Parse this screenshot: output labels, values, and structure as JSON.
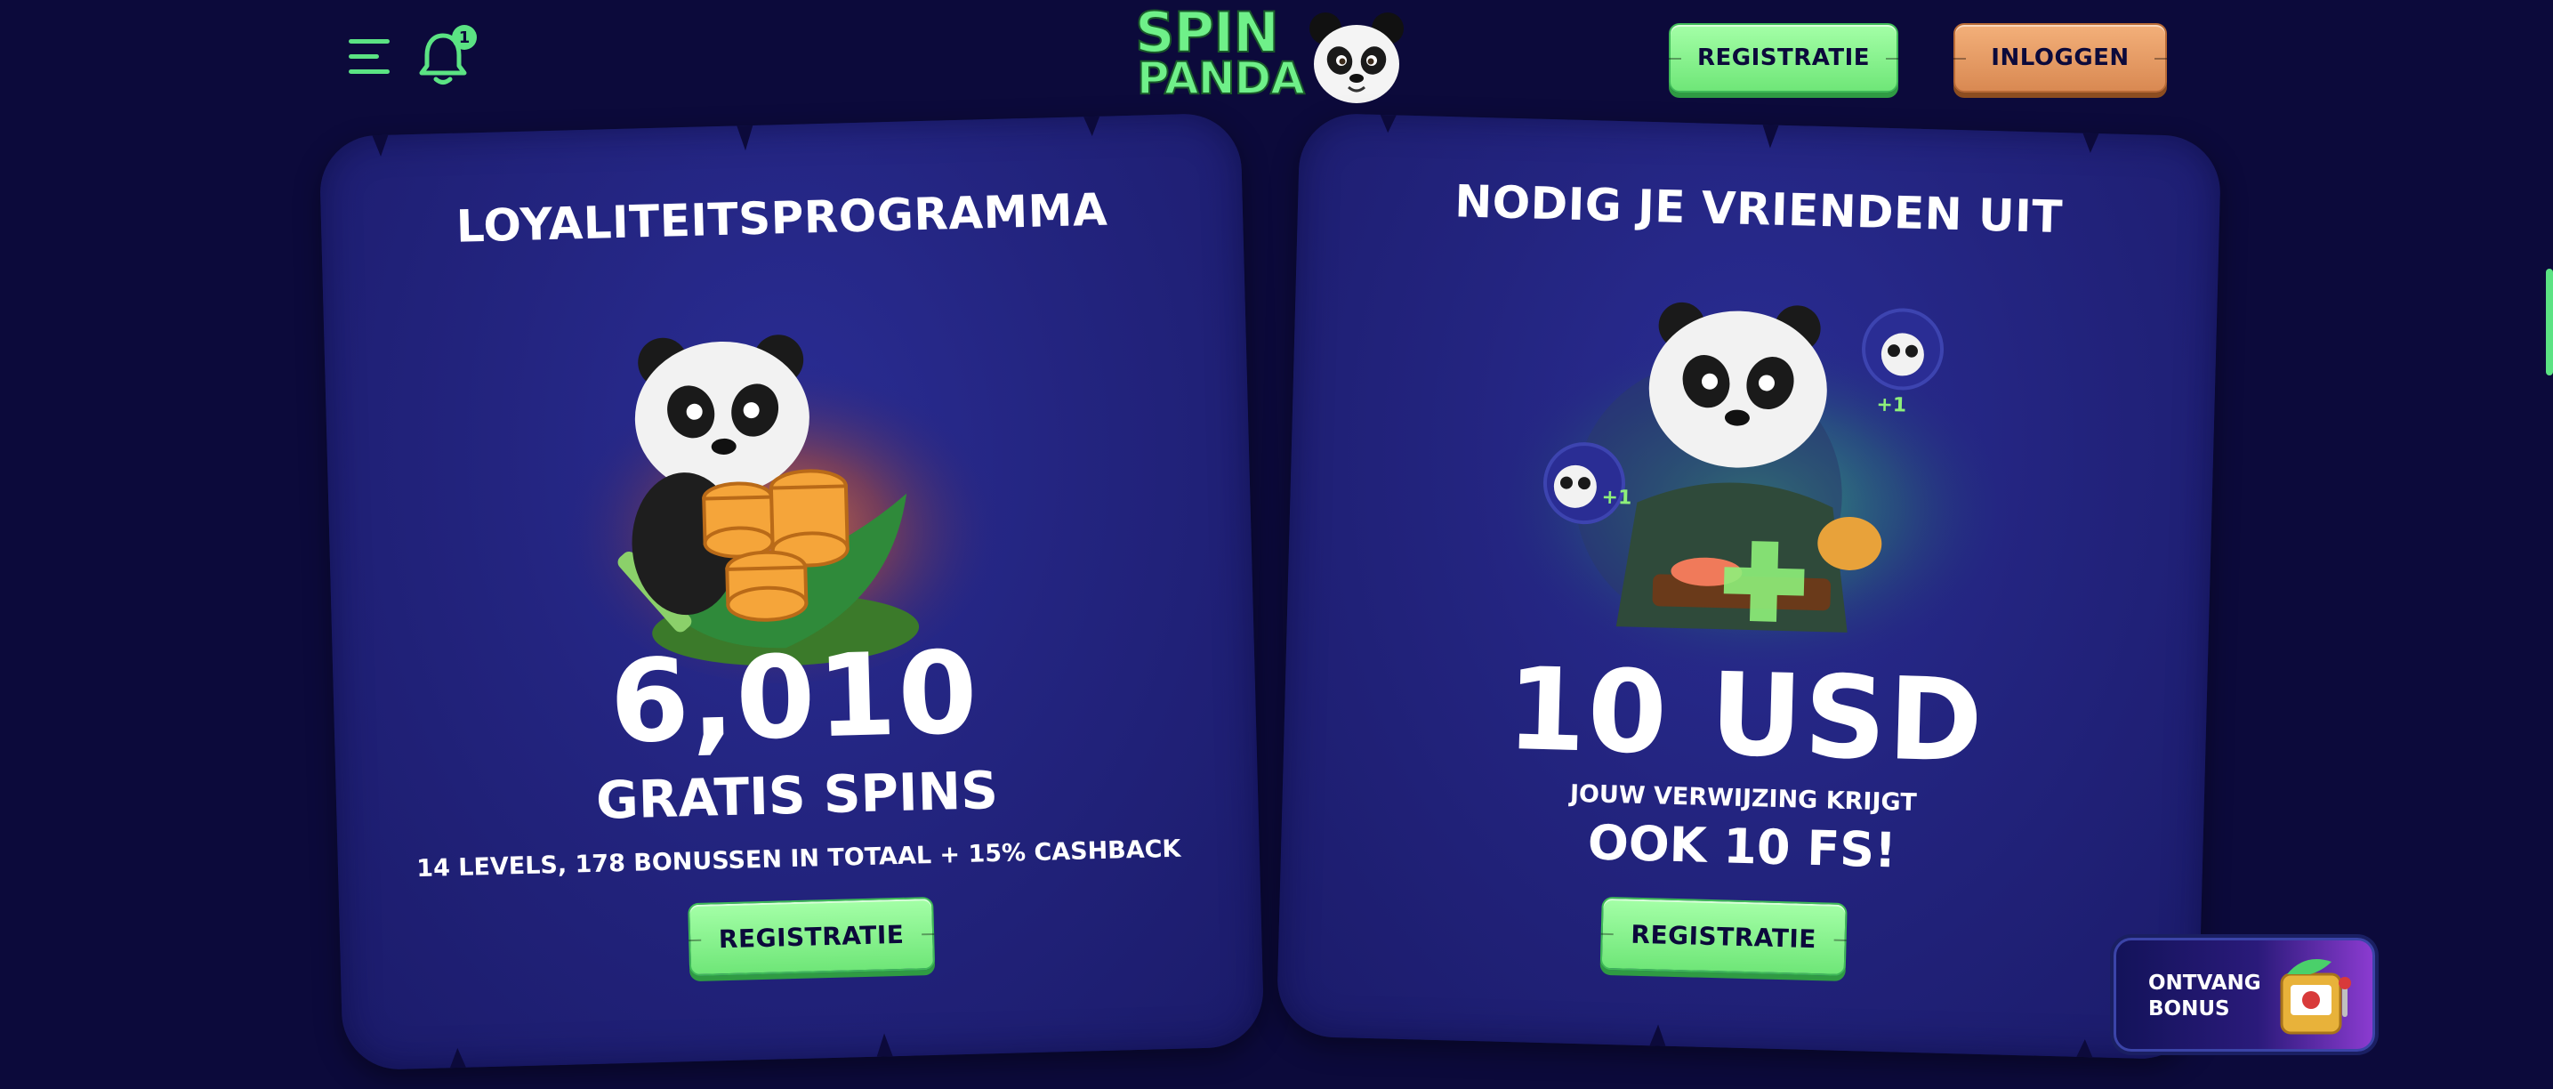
{
  "header": {
    "notification_count": "1",
    "logo_line1": "SPIN",
    "logo_line2": "PANDA",
    "register_label": "REGISTRATIE",
    "login_label": "INLOGGEN"
  },
  "cards": {
    "loyalty": {
      "title": "LOYALITEITSPROGRAMMA",
      "amount": "6,010",
      "amount_label": "GRATIS SPINS",
      "details": "14 LEVELS, 178 BONUSSEN IN TOTAAL + 15% CASHBACK",
      "button_label": "REGISTRATIE"
    },
    "invite": {
      "title": "NODIG JE VRIENDEN UIT",
      "amount": "10 USD",
      "details": "JOUW VERWIJZING KRIJGT",
      "extra": "OOK 10 FS!",
      "button_label": "REGISTRATIE",
      "badge_text": "+1"
    }
  },
  "bonus_widget": {
    "line1": "ONTVANG",
    "line2": "BONUS"
  },
  "colors": {
    "background": "#0c0a3b",
    "accent_green": "#6ff089",
    "accent_orange": "#e09a62",
    "card": "#23247f"
  }
}
